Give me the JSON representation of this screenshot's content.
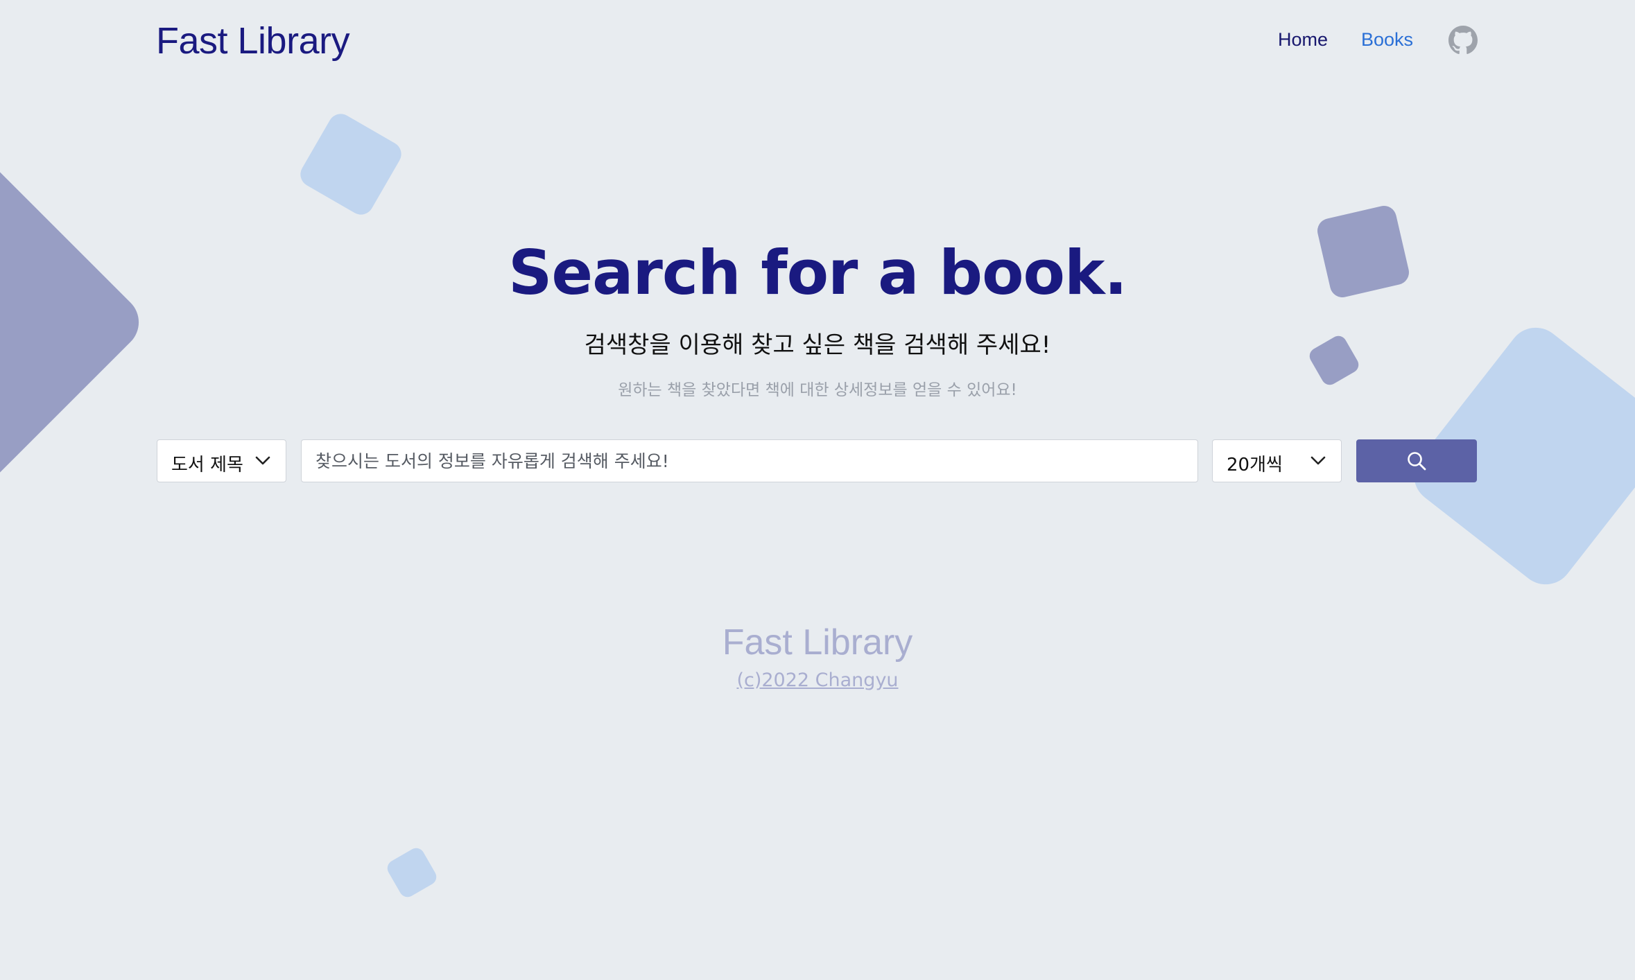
{
  "header": {
    "brand": "Fast Library",
    "nav": [
      {
        "label": "Home",
        "color": "#18186e"
      },
      {
        "label": "Books",
        "color": "#2a6fd6"
      }
    ],
    "github_icon": "github-icon"
  },
  "hero": {
    "title": "Search for a book.",
    "subtitle": "검색창을 이용해 찾고 싶은 책을 검색해 주세요!",
    "note": "원하는 책을 찾았다면 책에 대한 상세정보를 얻을 수 있어요!"
  },
  "search": {
    "field_select": {
      "selected": "도서 제목"
    },
    "input": {
      "value": "",
      "placeholder": "찾으시는 도서의 정보를 자유롭게 검색해 주세요!"
    },
    "count_select": {
      "selected": "20개씩"
    },
    "button_icon": "search-icon"
  },
  "footer": {
    "title": "Fast Library",
    "copyright": "(c)2022 Changyu"
  },
  "colors": {
    "background": "#e8ecf0",
    "brand": "#1a1a80",
    "accent_link": "#2a6fd6",
    "search_button": "#5c62a6",
    "shape_light": "#c0d5ef",
    "shape_dark": "#989ec4",
    "footer_text": "#a9aed0"
  }
}
